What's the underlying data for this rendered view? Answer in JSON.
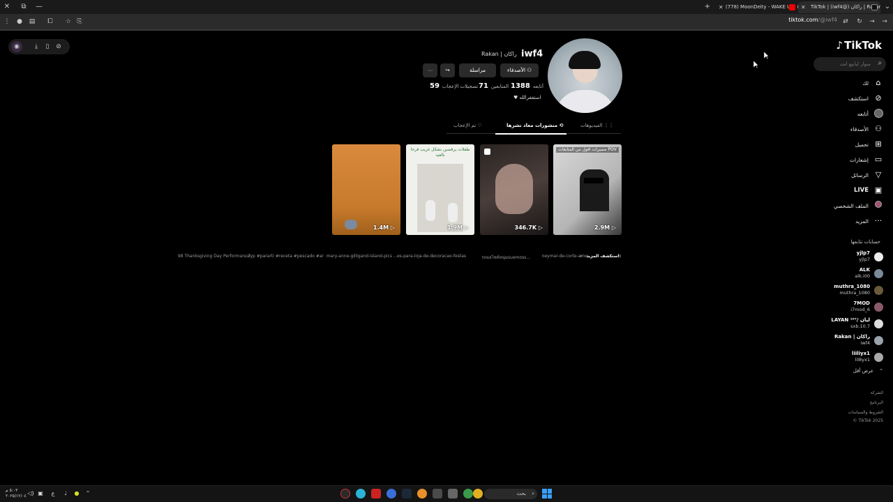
{
  "browser": {
    "tabs": [
      {
        "title": "(778) MoonDeity - WAKE UP! (",
        "active": false
      },
      {
        "title": "TikTok | (iwf4@) راكان | Rakan",
        "active": true
      }
    ],
    "new_tab": "+",
    "url_host": "tiktok.com",
    "url_path": "/@iwf4"
  },
  "sidebar": {
    "logo": "TikTok",
    "search_placeholder": "سوار لبابيع انت",
    "nav": [
      {
        "label": "لك",
        "icon": "home-icon"
      },
      {
        "label": "استكشف",
        "icon": "compass-icon"
      },
      {
        "label": "أتابعه",
        "icon": "avatar-icon"
      },
      {
        "label": "الأصدقاء",
        "icon": "friends-icon"
      },
      {
        "label": "تحميل",
        "icon": "upload-icon"
      },
      {
        "label": "إشعارات",
        "icon": "inbox-icon"
      },
      {
        "label": "الرسائل",
        "icon": "send-icon"
      },
      {
        "label": "LIVE",
        "icon": "live-icon"
      },
      {
        "label": "الملف الشخصي",
        "icon": "profile-icon"
      },
      {
        "label": "المزيد",
        "icon": "more-icon"
      }
    ],
    "following_title": "حسابات تتابعها",
    "following": [
      {
        "name": "yjlp7",
        "user": "yjlp7"
      },
      {
        "name": "ALK",
        "user": "alk.i00"
      },
      {
        "name": "muthra_1080",
        "user": "muthra_1080"
      },
      {
        "name": "7MOD",
        "user": "i7mod_6"
      },
      {
        "name": "LAYAN ¹⁰⁷/ ليان",
        "user": "sxb.10.7"
      },
      {
        "name": "Rakan | راكان",
        "user": "iwf4"
      },
      {
        "name": "liiliyx1",
        "user": "lil8yx1"
      }
    ],
    "show_less": "عرض أقل",
    "footer": [
      "الشركة",
      "البرنامج",
      "الشروط والسياسات",
      "© TikTok 2025"
    ]
  },
  "profile": {
    "username": "iwf4",
    "display_name": "Rakan | راكان",
    "buttons": {
      "add_friend": "الأصدقاء",
      "message": "مراسلة",
      "share": "share",
      "more": "···"
    },
    "stats": [
      {
        "num": "1388",
        "label": "أتابعه"
      },
      {
        "num": "71",
        "label": "المتابعين"
      },
      {
        "num": "59",
        "label": "تسجيلات الإعجاب"
      }
    ],
    "bio": "استغفرالله",
    "tabs": [
      {
        "label": "الفيديوهات",
        "active": false
      },
      {
        "label": "منشورات معاد نشرها",
        "active": true
      },
      {
        "label": "تم الإعجاب",
        "active": false
      }
    ]
  },
  "videos": [
    {
      "views": "2.9M",
      "caption": "مسيرات افول من المتابعات POV"
    },
    {
      "views": "346.7K",
      "caption": ""
    },
    {
      "views": "1.9M",
      "caption": "طفلات يرقصين بشكل غريب فرحا بالعيد"
    },
    {
      "views": "1.4M",
      "caption": ""
    }
  ],
  "explore": {
    "label": "استكشف المزيد:",
    "chips": [
      "neymar-de-corte-ame",
      "รถมอไซค์หนุ่มsuemoss...",
      "...es-para-loja-de-decoracao-festas",
      "mary-anne-gilligand-island-pics",
      "...fyp #pararti #receta #pescado #ar",
      "98 Thanksgiving Day Performance"
    ]
  },
  "taskbar": {
    "time": "٥:٠٣ م",
    "date": "٢٠٢٥/١٢/٠٤",
    "search": "بحث",
    "lang": "ع"
  },
  "colors": {
    "background": "#000000",
    "accent": "#fe2c55",
    "taskbar_start": "#3aa0ff"
  }
}
